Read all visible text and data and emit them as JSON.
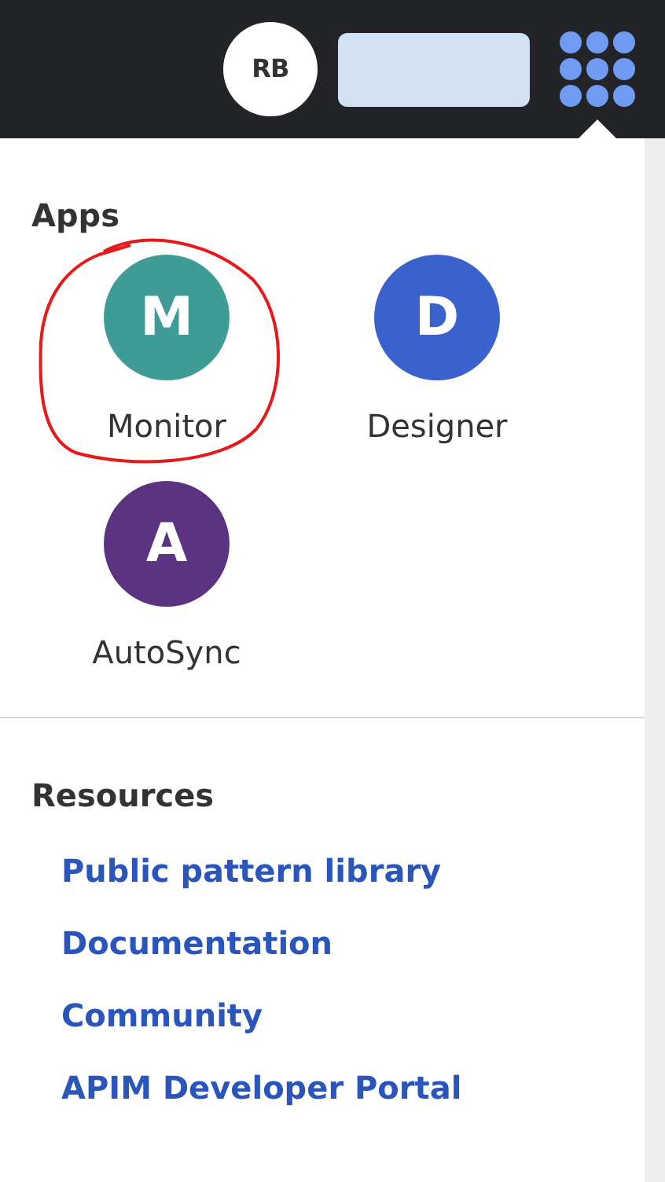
{
  "top_bar": {
    "avatar": "RB"
  },
  "apps_section": {
    "title": "Apps",
    "apps": [
      {
        "letter": "M",
        "name": "Monitor",
        "color": "#3f9b96",
        "circled": true
      },
      {
        "letter": "D",
        "name": "Designer",
        "color": "#3a62cc",
        "circled": false
      },
      {
        "letter": "A",
        "name": "AutoSync",
        "color": "#5b3380",
        "circled": false
      }
    ]
  },
  "resources_section": {
    "title": "Resources",
    "links": [
      "Public pattern library",
      "Documentation",
      "Community",
      "APIM Developer Portal"
    ]
  }
}
